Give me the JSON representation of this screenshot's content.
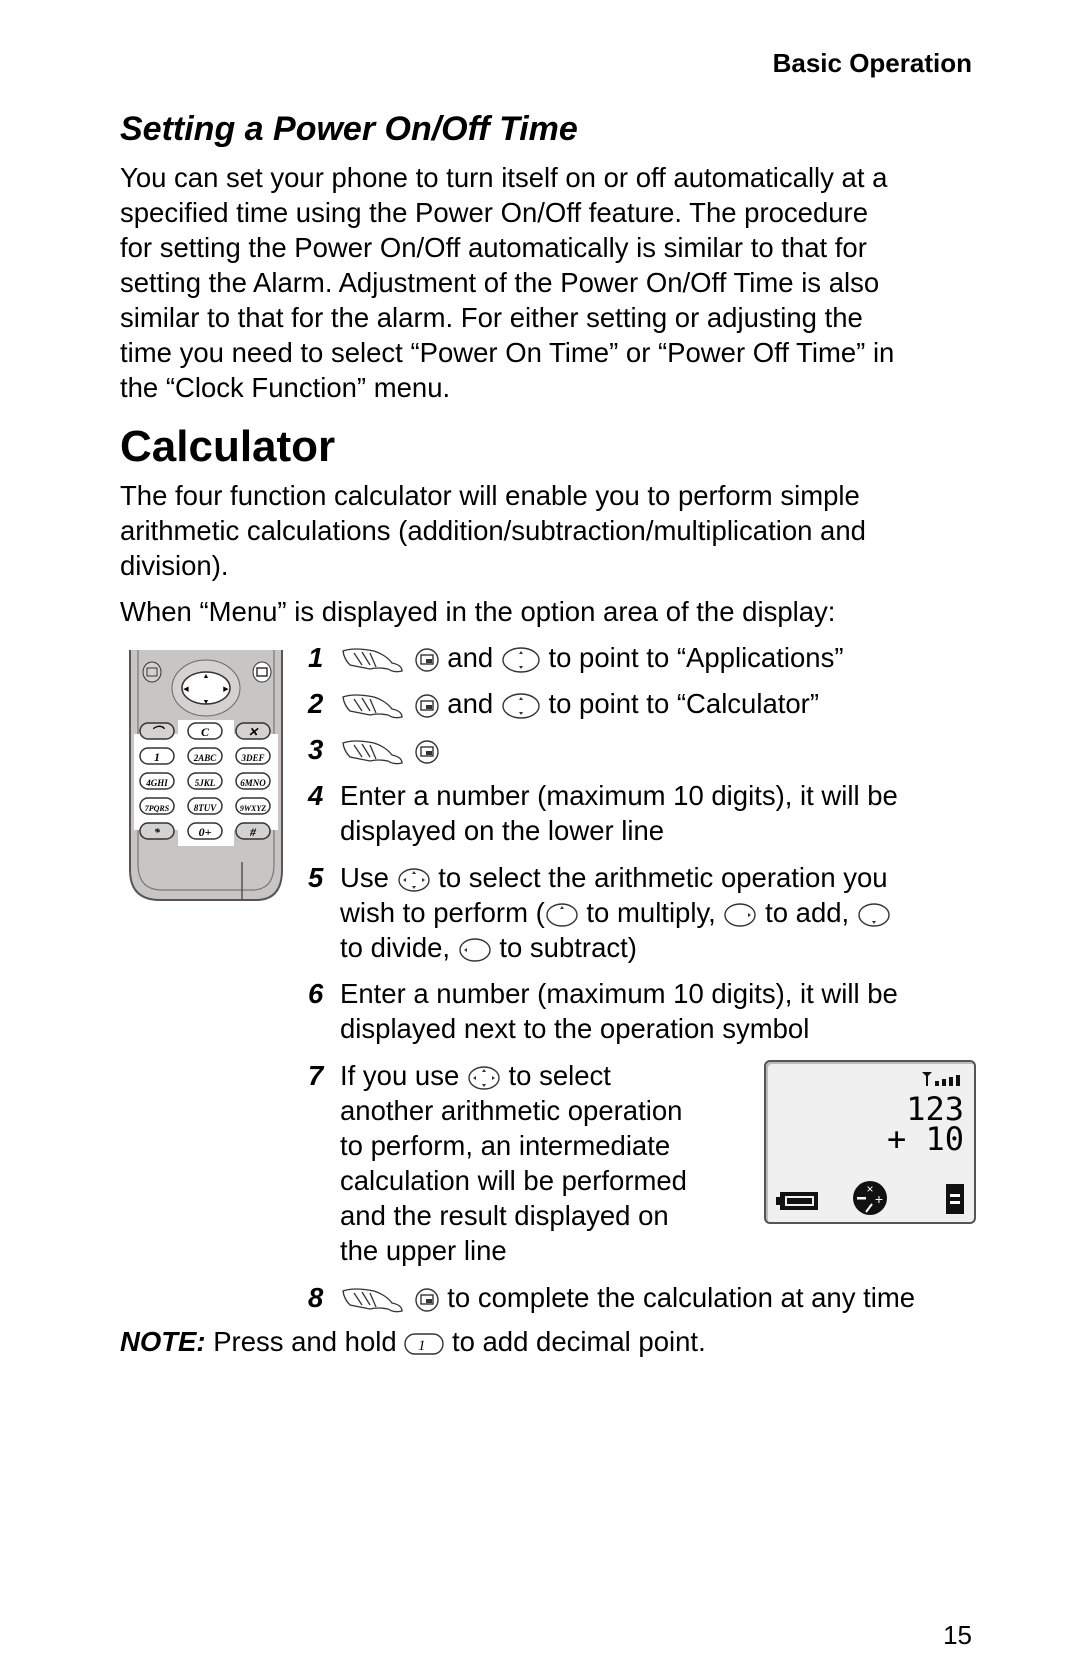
{
  "header": {
    "section": "Basic Operation"
  },
  "power_section": {
    "title": "Setting a Power On/Off Time",
    "lines": [
      "You can set your phone to turn itself on or off automatically at a",
      "specified time using the Power On/Off feature. The procedure",
      "for setting the Power On/Off automatically is similar to that for",
      "setting the Alarm. Adjustment of the Power On/Off Time is also",
      "similar to that for the alarm. For either setting or adjusting the",
      "time you need to select “Power On Time” or “Power Off Time” in",
      "the “Clock Function” menu."
    ]
  },
  "calculator_section": {
    "title": "Calculator",
    "intro_lines": [
      "The four function calculator will enable you to perform simple",
      "arithmetic calculations (addition/subtraction/multiplication and",
      "division)."
    ],
    "menu_prompt": "When “Menu” is displayed in the option area of the display:",
    "steps": [
      {
        "num": "1",
        "and": "and",
        "text": "to point to “Applications”"
      },
      {
        "num": "2",
        "and": "and",
        "text": "to point to “Calculator”"
      },
      {
        "num": "3"
      },
      {
        "num": "4",
        "lines": [
          "Enter a number (maximum 10 digits), it will be",
          "displayed on the lower line"
        ]
      },
      {
        "num": "5",
        "use": "Use",
        "l1": "to select the arithmetic operation you",
        "l2a": "wish to perform (",
        "mult": "to multiply,",
        "add": "to add,",
        "div": "to divide,",
        "sub": "to subtract)"
      },
      {
        "num": "6",
        "lines": [
          "Enter a number (maximum 10 digits), it will be",
          "displayed next to the operation symbol"
        ]
      },
      {
        "num": "7",
        "l1a": "If you use",
        "l1b": "to select",
        "lines": [
          "another arithmetic operation",
          "to perform, an intermediate",
          "calculation will be performed",
          "and the result displayed on",
          "the upper line"
        ]
      },
      {
        "num": "8",
        "text": "to complete the calculation at any time"
      }
    ],
    "note": {
      "label": "NOTE:",
      "pre": "Press and hold",
      "key": "1",
      "post": "to add decimal point."
    }
  },
  "phone_keypad": {
    "keys": [
      "C",
      "1",
      "2ABC",
      "3DEF",
      "4GHI",
      "5JKL",
      "6MNO",
      "7PQRS",
      "8TUV",
      "9WXYZ",
      "*",
      "0+",
      "#"
    ]
  },
  "lcd_display": {
    "upper_line": "123",
    "lower_line": "+ 10",
    "op_symbols": [
      "×",
      "−",
      "+",
      "/"
    ],
    "equals": "="
  },
  "page_number": "15"
}
